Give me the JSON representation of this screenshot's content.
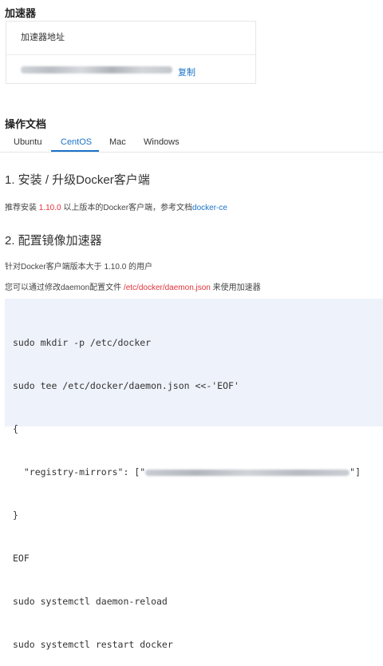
{
  "accelerator": {
    "section_title": "加速器",
    "card_header": "加速器地址",
    "copy_label": "复制"
  },
  "docs": {
    "section_title": "操作文档",
    "tabs": [
      "Ubuntu",
      "CentOS",
      "Mac",
      "Windows"
    ],
    "active_tab": "CentOS"
  },
  "step1": {
    "heading": "1. 安装 / 升级Docker客户端",
    "text_prefix": "推荐安装 ",
    "version": "1.10.0",
    "text_middle": " 以上版本的Docker客户端，参考文档",
    "link": "docker-ce"
  },
  "step2": {
    "heading": "2. 配置镜像加速器",
    "note1": "针对Docker客户端版本大于 1.10.0 的用户",
    "note2_prefix": "您可以通过修改daemon配置文件 ",
    "config_path": "/etc/docker/daemon.json",
    "note2_suffix": " 来使用加速器"
  },
  "code": {
    "line1": "sudo mkdir -p /etc/docker",
    "line2": "sudo tee /etc/docker/daemon.json <<-'EOF'",
    "line3": "{",
    "line4_prefix": "  \"registry-mirrors\": [\"",
    "line4_suffix": "\"]",
    "line5": "}",
    "line6": "EOF",
    "line7": "sudo systemctl daemon-reload",
    "line8": "sudo systemctl restart docker"
  },
  "colors": {
    "accent": "#1a73c8",
    "highlight": "#e0323c",
    "code_background": "#eef2fa"
  }
}
